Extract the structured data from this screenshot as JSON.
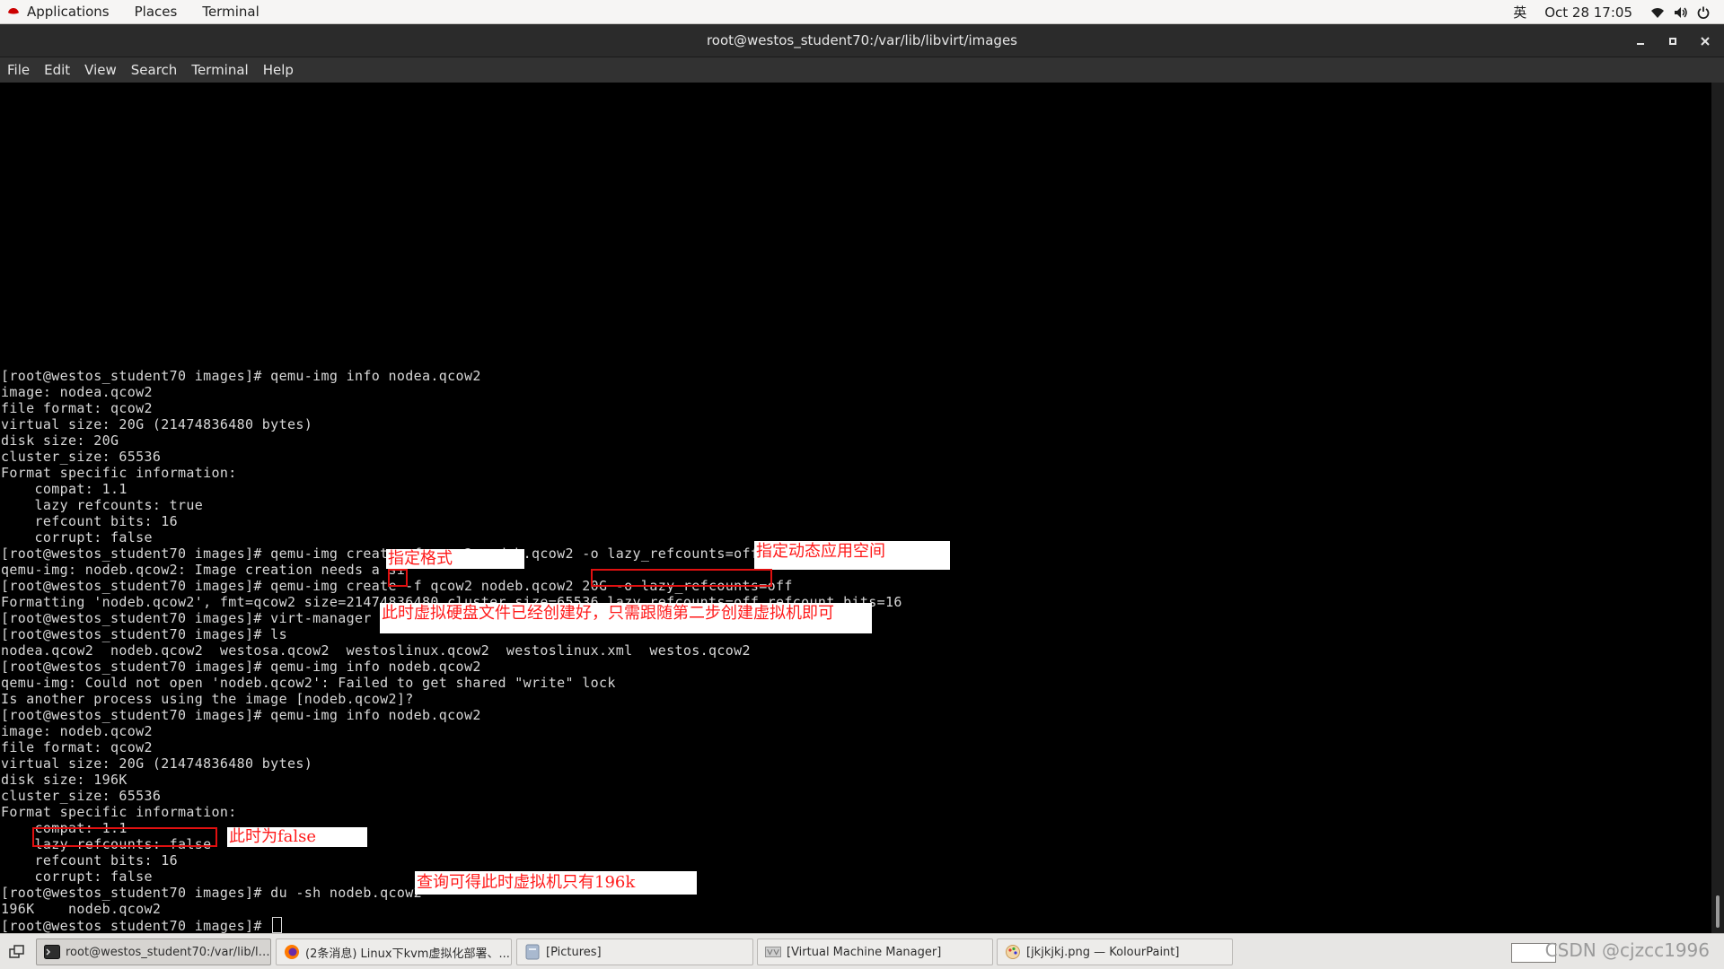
{
  "topbar": {
    "applications": "Applications",
    "places": "Places",
    "terminal": "Terminal",
    "input_method": "英",
    "clock": "Oct 28  17:05",
    "icons": [
      "redhat-icon",
      "wifi-icon",
      "volume-icon",
      "power-icon"
    ]
  },
  "window": {
    "title": "root@westos_student70:/var/lib/libvirt/images",
    "controls": [
      "minimize-icon",
      "maximize-icon",
      "close-icon"
    ]
  },
  "menubar": [
    "File",
    "Edit",
    "View",
    "Search",
    "Terminal",
    "Help"
  ],
  "terminal": {
    "lines": [
      "[root@westos_student70 images]# qemu-img info nodea.qcow2",
      "image: nodea.qcow2",
      "file format: qcow2",
      "virtual size: 20G (21474836480 bytes)",
      "disk size: 20G",
      "cluster_size: 65536",
      "Format specific information:",
      "    compat: 1.1",
      "    lazy refcounts: true",
      "    refcount bits: 16",
      "    corrupt: false",
      "[root@westos_student70 images]# qemu-img create -f qcow2 nodeb.qcow2 -o lazy_refcounts=off",
      "qemu-img: nodeb.qcow2: Image creation needs a si",
      "[root@westos_student70 images]# qemu-img create -f qcow2 nodeb.qcow2 20G -o lazy_refcounts=off",
      "Formatting 'nodeb.qcow2', fmt=qcow2 size=21474836480 cluster_size=65536 lazy_refcounts=off refcount_bits=16",
      "[root@westos_student70 images]# virt-manager",
      "[root@westos_student70 images]# ls",
      "nodea.qcow2  nodeb.qcow2  westosa.qcow2  westoslinux.qcow2  westoslinux.xml  westos.qcow2",
      "[root@westos_student70 images]# qemu-img info nodeb.qcow2",
      "qemu-img: Could not open 'nodeb.qcow2': Failed to get shared \"write\" lock",
      "Is another process using the image [nodeb.qcow2]?",
      "[root@westos_student70 images]# qemu-img info nodeb.qcow2",
      "image: nodeb.qcow2",
      "file format: qcow2",
      "virtual size: 20G (21474836480 bytes)",
      "disk size: 196K",
      "cluster_size: 65536",
      "Format specific information:",
      "    compat: 1.1",
      "    lazy refcounts: false",
      "    refcount bits: 16",
      "    corrupt: false",
      "[root@westos_student70 images]# du -sh nodeb.qcow2",
      "196K    nodeb.qcow2",
      "[root@westos_student70 images]# "
    ]
  },
  "annotations": {
    "dynamic_space": "指定动态应用空间",
    "format": "指定格式",
    "disk_created": "此时虚拟硬盘文件已经创建好，只需跟随第二步创建虚拟机即可",
    "is_false": "此时为false",
    "query_196k": "查询可得此时虚拟机只有196k"
  },
  "taskbar": {
    "tasks": [
      {
        "label": "root@westos_student70:/var/lib/lib...",
        "icon": "terminal-icon"
      },
      {
        "label": "(2条消息) Linux下kvm虚拟化部署、...",
        "icon": "firefox-icon"
      },
      {
        "label": "[Pictures]",
        "icon": "files-icon"
      },
      {
        "label": "[Virtual Machine Manager]",
        "icon": "virt-manager-icon"
      },
      {
        "label": "[jkjkjkj.png  — KolourPaint]",
        "icon": "kolourpaint-icon"
      }
    ],
    "watermark": "CSDN @cjzcc1996"
  },
  "colors": {
    "terminal_bg": "#000000",
    "terminal_fg": "#d8d8d8",
    "annotation_red": "#ff1a1a",
    "box_red": "#e01010"
  }
}
